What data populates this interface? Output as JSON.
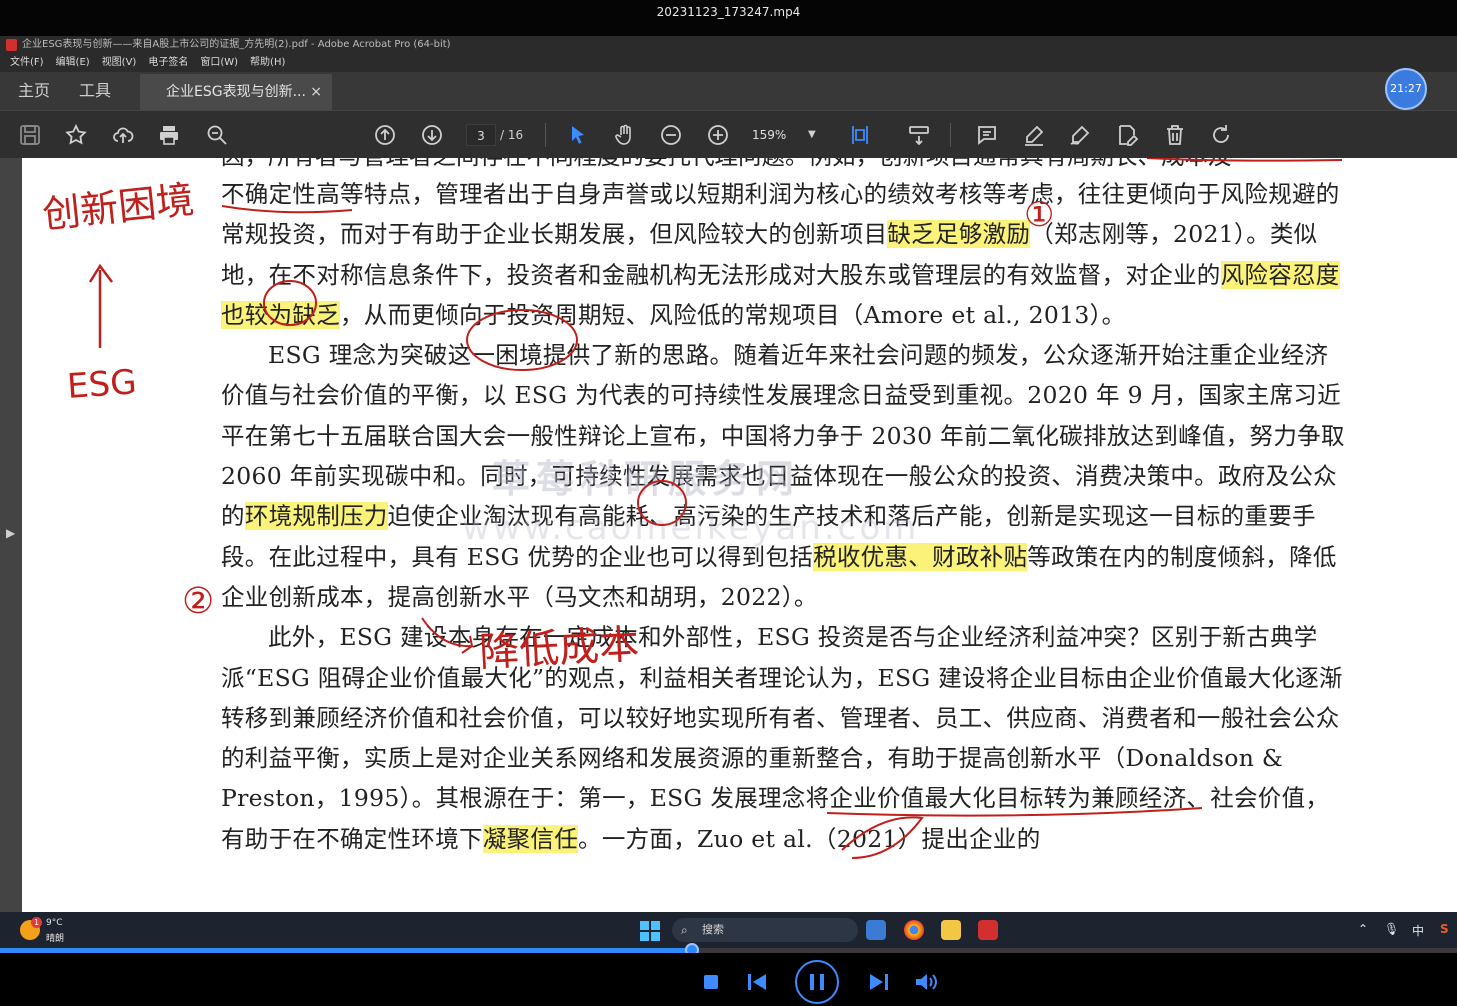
{
  "player": {
    "title": "20231123_173247.mp4"
  },
  "window": {
    "title": "企业ESG表现与创新——来自A股上市公司的证据_方先明(2).pdf - Adobe Acrobat Pro (64-bit)"
  },
  "menu": [
    "文件(F)",
    "编辑(E)",
    "视图(V)",
    "电子签名",
    "窗口(W)",
    "帮助(H)"
  ],
  "tabs": {
    "home": "主页",
    "tools": "工具",
    "document": "企业ESG表现与创新...",
    "close": "×"
  },
  "clock": "21:27",
  "toolbar": {
    "page_current": "3",
    "page_total": "/ 16",
    "zoom": "159%"
  },
  "document": {
    "top_cut": "因，所有者与管理者之间存在不同程度的委托代理问题。例如，创新项目通常具有周期长、成本及",
    "p1_a": "不确定性高等特点，管理者出于自身声誉或以短期利润为核心的绩效考核等考虑，往往更倾向于风险规避的常规投资，而对于有助于企业长期发展，但风险较大的创新项目",
    "p1_hl1": "缺乏足够激励",
    "p1_b": "（郑志刚等，2021）。类似地，在不对称信息条件下，投资者和金融机构无法形成对大股东或管理层的有效监督，对企业的",
    "p1_hl2": "风险容忍度也较为缺乏",
    "p1_c": "，从而更倾向于投资周期短、风险低的常规项目（Amore et al., 2013）。",
    "p2_a": "ESG 理念为突破这一困境提供了新的思路。随着近年来社会问题的频发，公众逐渐开始注重企业经济价值与社会价值的平衡，以 ESG 为代表的可持续性发展理念日益受到重视。2020 年 9 月，国家主席习近平在第七十五届联合国大会一般性辩论上宣布，中国将力争于 2030 年前二氧化碳排放达到峰值，努力争取 2060 年前实现碳中和。同时，可持续性发展需求也日益体现在一般公众的投资、消费决策中。政府及公众的",
    "p2_hl1": "环境规制压力",
    "p2_b": "迫使企业淘汰现有高能耗、高污染的生产技术和落后产能，创新是实现这一目标的重要手段。在此过程中，具有 ESG 优势的企业也可以得到包括",
    "p2_hl2": "税收优惠、财政补贴",
    "p2_c": "等政策在内的制度倾斜，降低企业创新成本，提高创新水平（马文杰和胡玥，2022）。",
    "p3_a": "此外，ESG 建设本身存在一定成本和外部性，ESG 投资是否与企业经济利益冲突？区别于新古典学派“ESG 阻碍企业价值最大化”的观点，利益相关者理论认为，ESG 建设将企业目标由企业价值最大化逐渐转移到兼顾经济价值和社会价值，可以较好地实现所有者、管理者、员工、供应商、消费者和一般社会公众的利益平衡，实质上是对企业关系网络和发展资源的重新整合，有助于提高创新水平（Donaldson & Preston，1995）。其根源在于：第一，ESG 发展理念将企业价值最大化目标转为兼顾经济、社会价值，有助于在不确定性环境下",
    "p3_hl1": "凝聚信任",
    "p3_b": "。一方面，Zuo et al.（2021）提出企业的"
  },
  "annotations": {
    "innovation_dilemma": "创新困境",
    "esg": "ESG",
    "reduce_cost": "降低成本",
    "num1": "①",
    "num2": "②"
  },
  "watermark": {
    "line1": "草莓科研服务网",
    "line2": "www.caomeikeyan.com"
  },
  "taskbar": {
    "temperature": "9°C",
    "weather": "晴朗",
    "weather_badge": "1",
    "search": "搜索",
    "ime": "中"
  },
  "playback": {
    "progress": 0.475
  },
  "colors": {
    "highlight": "#fbf27a",
    "ink_red": "#c0201c",
    "accent": "#2f8cff"
  }
}
